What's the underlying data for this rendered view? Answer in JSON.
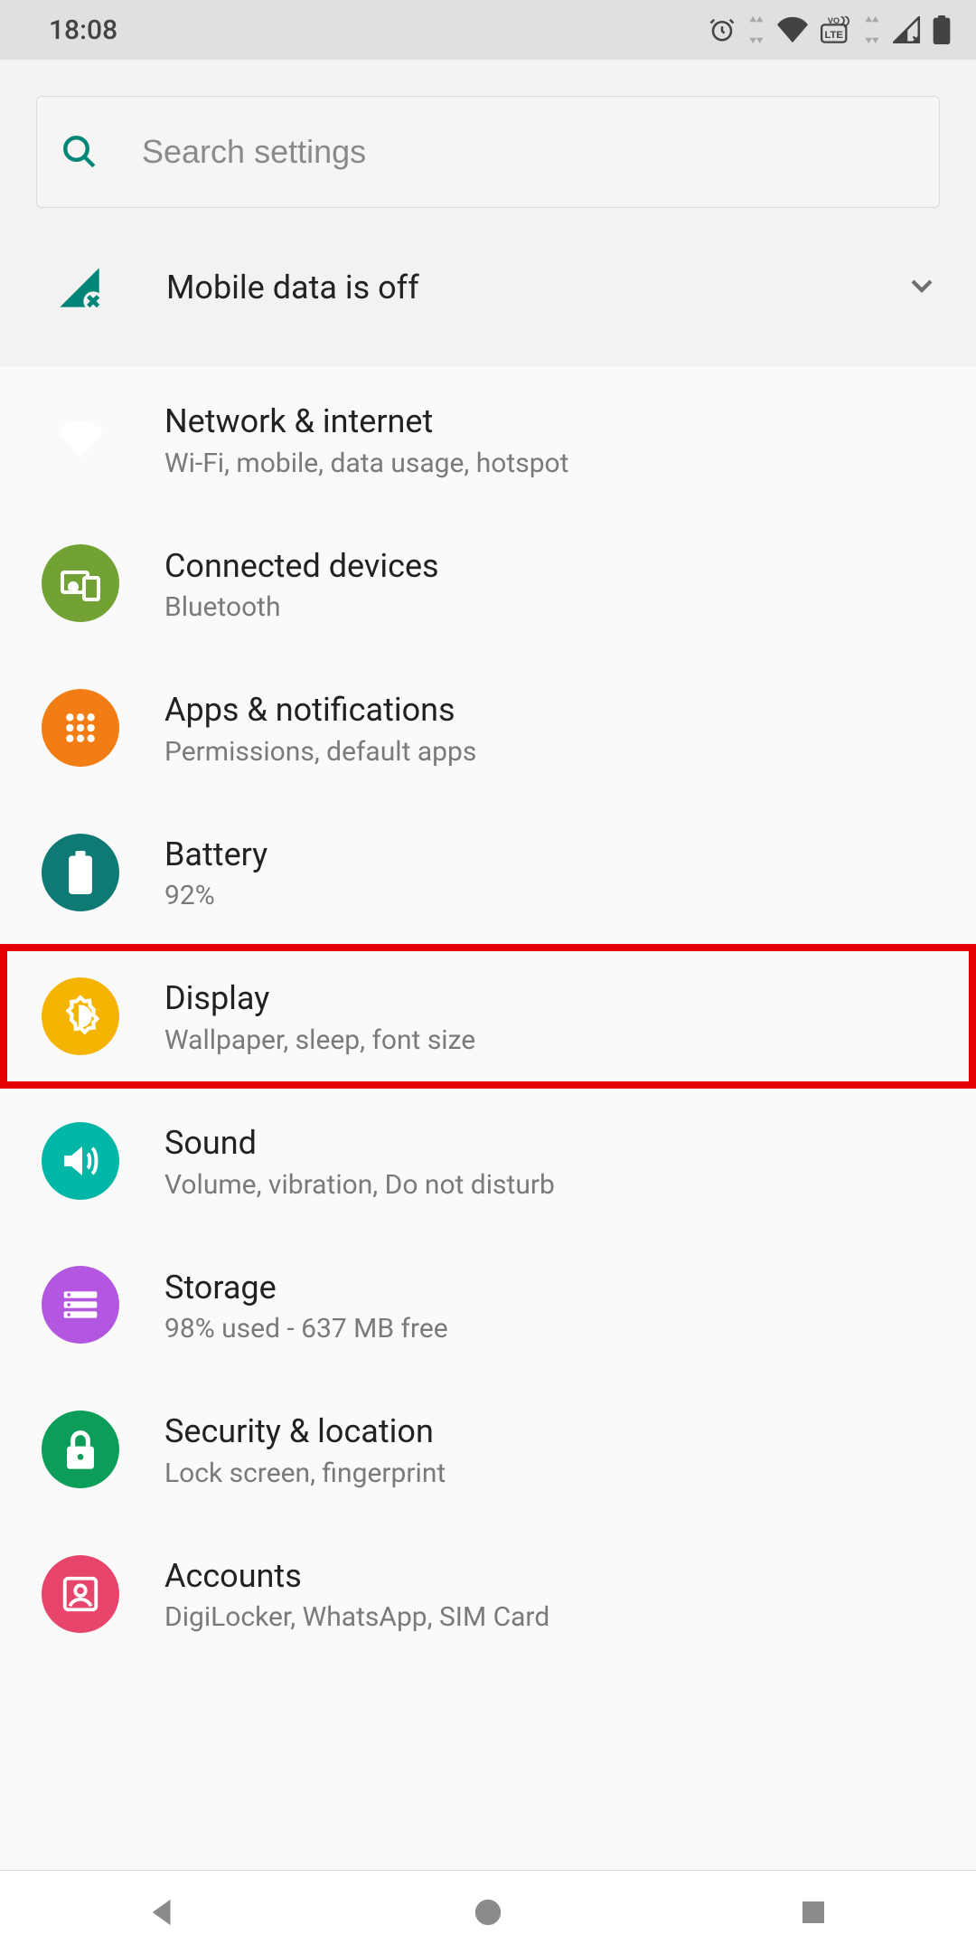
{
  "status": {
    "time": "18:08"
  },
  "search": {
    "placeholder": "Search settings"
  },
  "suggestion": {
    "label": "Mobile data is off"
  },
  "items": [
    {
      "title": "Network & internet",
      "sub": "Wi-Fi, mobile, data usage, hotspot",
      "color": "#1a81e8"
    },
    {
      "title": "Connected devices",
      "sub": "Bluetooth",
      "color": "#71a233"
    },
    {
      "title": "Apps & notifications",
      "sub": "Permissions, default apps",
      "color": "#f27d14"
    },
    {
      "title": "Battery",
      "sub": "92%",
      "color": "#0f7a73"
    },
    {
      "title": "Display",
      "sub": "Wallpaper, sleep, font size",
      "color": "#f5b400"
    },
    {
      "title": "Sound",
      "sub": "Volume, vibration, Do not disturb",
      "color": "#00b6a6"
    },
    {
      "title": "Storage",
      "sub": "98% used - 637 MB free",
      "color": "#b457e0"
    },
    {
      "title": "Security & location",
      "sub": "Lock screen, fingerprint",
      "color": "#0c9d58"
    },
    {
      "title": "Accounts",
      "sub": "DigiLocker, WhatsApp, SIM Card",
      "color": "#e8456d"
    }
  ]
}
